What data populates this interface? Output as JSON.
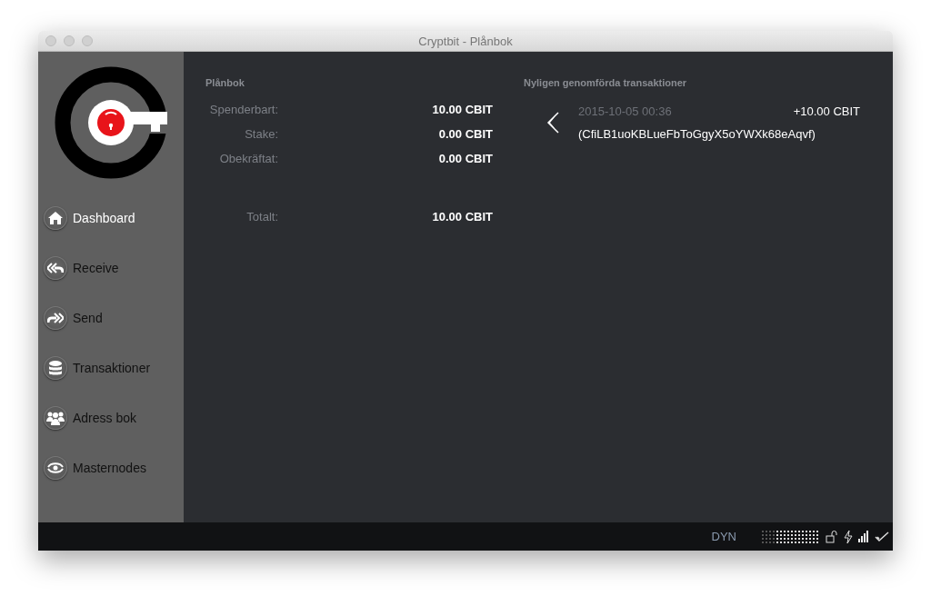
{
  "window": {
    "title": "Cryptbit - Plånbok"
  },
  "sidebar": {
    "items": [
      {
        "label": "Dashboard",
        "kind": "home",
        "selected": true
      },
      {
        "label": "Receive",
        "kind": "receive",
        "selected": false
      },
      {
        "label": "Send",
        "kind": "send",
        "selected": false
      },
      {
        "label": "Transaktioner",
        "kind": "database",
        "selected": false
      },
      {
        "label": "Adress bok",
        "kind": "people",
        "selected": false
      },
      {
        "label": "Masternodes",
        "kind": "eye",
        "selected": false
      }
    ]
  },
  "wallet": {
    "heading": "Plånbok",
    "rows": [
      {
        "label": "Spenderbart:",
        "value": "10.00 CBIT"
      },
      {
        "label": "Stake:",
        "value": "0.00 CBIT"
      },
      {
        "label": "Obekräftat:",
        "value": "0.00 CBIT"
      }
    ],
    "total": {
      "label": "Totalt:",
      "value": "10.00 CBIT"
    }
  },
  "recent": {
    "heading": "Nyligen genomförda transaktioner",
    "transactions": [
      {
        "date": "2015-10-05 00:36",
        "amount": "+10.00 CBIT",
        "address": "(CfiLB1uoKBLueFbToGgyX5oYWXk68eAqvf)"
      }
    ]
  },
  "status_bar": {
    "unit": "DYN"
  }
}
